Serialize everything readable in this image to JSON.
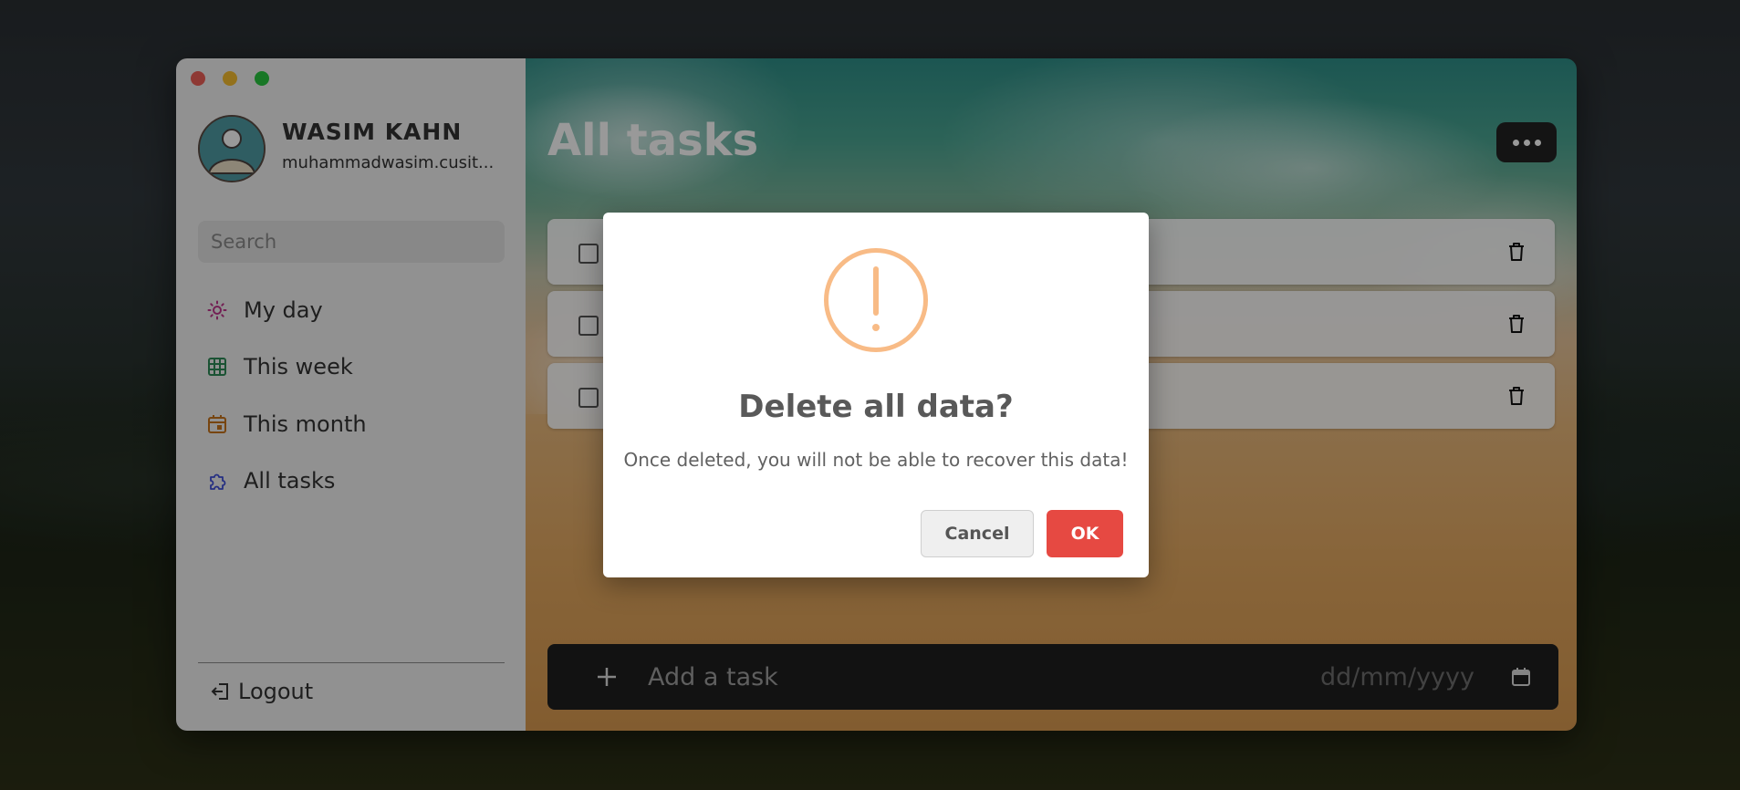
{
  "profile": {
    "name": "WASIM KAHN",
    "email": "muhammadwasim.cusit..."
  },
  "sidebar": {
    "search_placeholder": "Search",
    "items": [
      {
        "label": "My day",
        "icon": "sun-icon",
        "color": "#c0348c"
      },
      {
        "label": "This week",
        "icon": "grid-calendar-icon",
        "color": "#2e8b57"
      },
      {
        "label": "This month",
        "icon": "calendar-icon",
        "color": "#c7731c"
      },
      {
        "label": "All tasks",
        "icon": "puzzle-icon",
        "color": "#3f4fd9"
      }
    ],
    "logout_label": "Logout"
  },
  "main": {
    "title": "All tasks",
    "add_task_placeholder": "Add a task",
    "date_placeholder": "dd/mm/yyyy"
  },
  "dialog": {
    "title": "Delete all data?",
    "text": "Once deleted, you will not be able to recover this data!",
    "cancel_label": "Cancel",
    "ok_label": "OK",
    "warning_color": "#f8bb86",
    "ok_color": "#e64942"
  }
}
